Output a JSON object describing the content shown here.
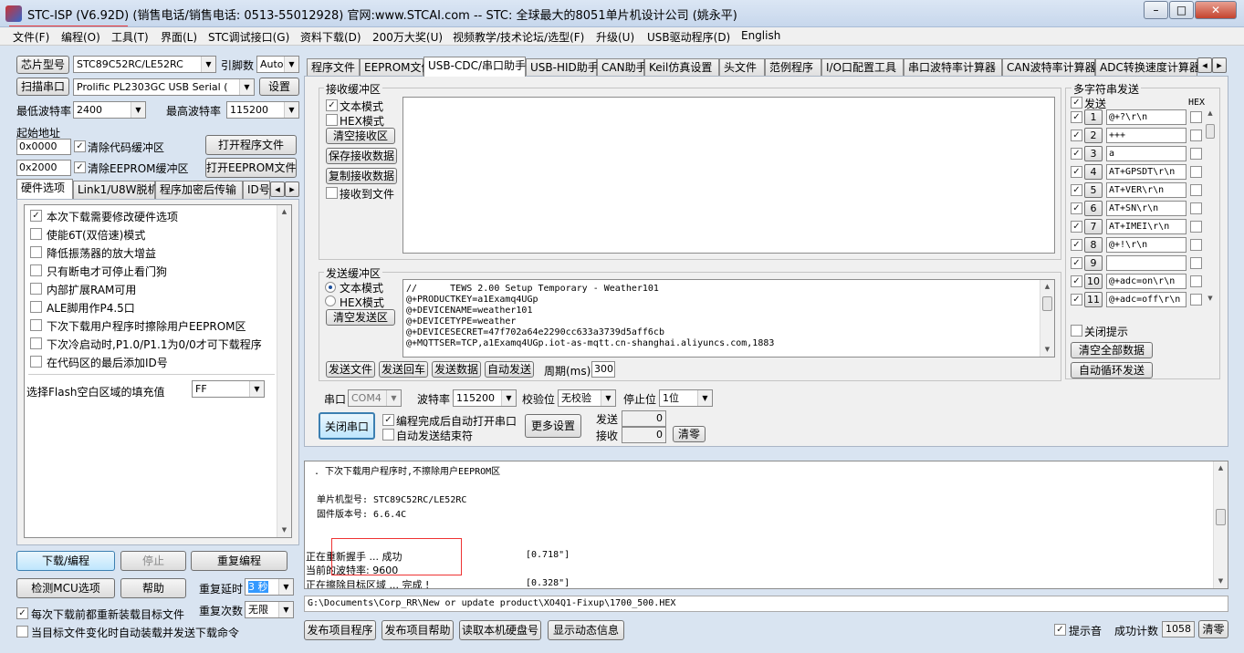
{
  "window": {
    "title": "STC-ISP (V6.92D) (销售电话/销售电话: 0513-55012928) 官网:www.STCAI.com  -- STC: 全球最大的8051单片机设计公司 (姚永平)",
    "min_label": "–",
    "max_label": "□",
    "close_label": "✕"
  },
  "menu": [
    "文件(F)",
    "编程(O)",
    "工具(T)",
    "界面(L)",
    "STC调试接口(G)",
    "资料下载(D)",
    "200万大奖(U)",
    "视频教学/技术论坛/选型(F)",
    "升级(U)",
    "USB驱动程序(D)",
    "English"
  ],
  "left": {
    "chip_btn": "芯片型号",
    "chip_value": "STC89C52RC/LE52RC",
    "pins_label": "引脚数",
    "pins_value": "Auto",
    "scan_btn": "扫描串口",
    "port_value": "Prolific PL2303GC USB Serial (",
    "settings_btn": "设置",
    "min_baud_label": "最低波特率",
    "min_baud_value": "2400",
    "max_baud_label": "最高波特率",
    "max_baud_value": "115200",
    "start_addr_label": "起始地址",
    "addr1_value": "0x0000",
    "clear_code_label": "清除代码缓冲区",
    "open_prog_btn": "打开程序文件",
    "addr2_value": "0x2000",
    "clear_eeprom_label": "清除EEPROM缓冲区",
    "open_eeprom_btn": "打开EEPROM文件",
    "tabs": [
      "硬件选项",
      "Link1/U8W脱机",
      "程序加密后传输",
      "ID号"
    ],
    "hw_options": [
      {
        "label": "本次下载需要修改硬件选项",
        "checked": true
      },
      {
        "label": "使能6T(双倍速)模式",
        "checked": false
      },
      {
        "label": "降低振荡器的放大增益",
        "checked": false
      },
      {
        "label": "只有断电才可停止看门狗",
        "checked": false
      },
      {
        "label": "内部扩展RAM可用",
        "checked": false
      },
      {
        "label": "ALE脚用作P4.5口",
        "checked": false
      },
      {
        "label": "下次下载用户程序时擦除用户EEPROM区",
        "checked": false
      },
      {
        "label": "下次冷启动时,P1.0/P1.1为0/0才可下载程序",
        "checked": false
      },
      {
        "label": "在代码区的最后添加ID号",
        "checked": false
      }
    ],
    "fill_label": "选择Flash空白区域的填充值",
    "fill_value": "FF",
    "download_btn": "下载/编程",
    "stop_btn": "停止",
    "reprogram_btn": "重复编程",
    "detect_btn": "检测MCU选项",
    "help_btn": "帮助",
    "repeat_delay_label": "重复延时",
    "repeat_delay_value": "3 秒",
    "reload_label": "每次下载前都重新装载目标文件",
    "repeat_count_label": "重复次数",
    "repeat_count_value": "无限",
    "auto_label": "当目标文件变化时自动装载并发送下载命令"
  },
  "right_tabs": [
    "程序文件",
    "EEPROM文件",
    "USB-CDC/串口助手",
    "USB-HID助手",
    "CAN助手",
    "Keil仿真设置",
    "头文件",
    "范例程序",
    "I/O口配置工具",
    "串口波特率计算器",
    "CAN波特率计算器",
    "ADC转换速度计算器"
  ],
  "serial": {
    "recv_group": "接收缓冲区",
    "text_mode": "文本模式",
    "hex_mode": "HEX模式",
    "clear_recv_btn": "清空接收区",
    "save_recv_btn": "保存接收数据",
    "copy_recv_btn": "复制接收数据",
    "recv_to_file": "接收到文件",
    "send_group": "发送缓冲区",
    "send_text_mode": "文本模式",
    "send_hex_mode": "HEX模式",
    "clear_send_btn": "清空发送区",
    "send_lines": [
      "//      TEWS 2.00 Setup Temporary - Weather101",
      "@+PRODUCTKEY=a1Examq4UGp",
      "@+DEVICENAME=weather101",
      "@+DEVICETYPE=weather",
      "@+DEVICESECRET=47f702a64e2290cc633a3739d5aff6cb",
      "@+MQTTSER=TCP,a1Examq4UGp.iot-as-mqtt.cn-shanghai.aliyuncs.com,1883"
    ],
    "send_file_btn": "发送文件",
    "send_cr_btn": "发送回车",
    "send_data_btn": "发送数据",
    "auto_send_btn": "自动发送",
    "period_label": "周期(ms)",
    "period_value": "300",
    "port_label": "串口",
    "port_value": "COM4",
    "baud_label": "波特率",
    "baud_value": "115200",
    "parity_label": "校验位",
    "parity_value": "无校验",
    "stop_label": "停止位",
    "stop_value": "1位",
    "close_port_btn": "关闭串口",
    "auto_open_label": "编程完成后自动打开串口",
    "auto_end_label": "自动发送结束符",
    "more_btn": "更多设置",
    "send_count_label": "发送",
    "send_count_value": "0",
    "recv_count_label": "接收",
    "recv_count_value": "0",
    "clear_count_btn": "清零"
  },
  "multi": {
    "title": "多字符串发送",
    "send_header": "发送",
    "hex_header": "HEX",
    "rows": [
      {
        "n": "1",
        "text": "@+?\\r\\n",
        "checked": true
      },
      {
        "n": "2",
        "text": "+++",
        "checked": true
      },
      {
        "n": "3",
        "text": "a",
        "checked": true
      },
      {
        "n": "4",
        "text": "AT+GPSDT\\r\\n",
        "checked": true
      },
      {
        "n": "5",
        "text": "AT+VER\\r\\n",
        "checked": true
      },
      {
        "n": "6",
        "text": "AT+SN\\r\\n",
        "checked": true
      },
      {
        "n": "7",
        "text": "AT+IMEI\\r\\n",
        "checked": true
      },
      {
        "n": "8",
        "text": "@+!\\r\\n",
        "checked": true
      },
      {
        "n": "9",
        "text": "",
        "checked": true
      },
      {
        "n": "10",
        "text": "@+adc=on\\r\\n",
        "checked": true
      },
      {
        "n": "11",
        "text": "@+adc=off\\r\\n",
        "checked": true
      }
    ],
    "close_tip": "关闭提示",
    "clear_all_btn": "清空全部数据",
    "auto_loop_btn": "自动循环发送"
  },
  "log": {
    "line_top": ". 下次下载用户程序时,不擦除用户EEPROM区",
    "chip_line": "单片机型号: STC89C52RC/LE52RC",
    "fw_line": "固件版本号: 6.6.4C",
    "handshake_line": "正在重新握手 ... 成功",
    "handshake_time": "[0.718\"]",
    "baud_line": "当前的波特率: 9600",
    "erase_line": "正在擦除目标区域 ... 完成 !",
    "erase_time": "[0.328\"]"
  },
  "status_path": "G:\\Documents\\Corp_RR\\New or update product\\XO4Q1-Fixup\\1700_500.HEX",
  "bottom": {
    "publish_btn": "发布项目程序",
    "publish_help_btn": "发布项目帮助",
    "read_disk_btn": "读取本机硬盘号",
    "show_info_btn": "显示动态信息",
    "sound_label": "提示音",
    "success_label": "成功计数",
    "success_value": "1058",
    "clear_btn": "清零"
  }
}
